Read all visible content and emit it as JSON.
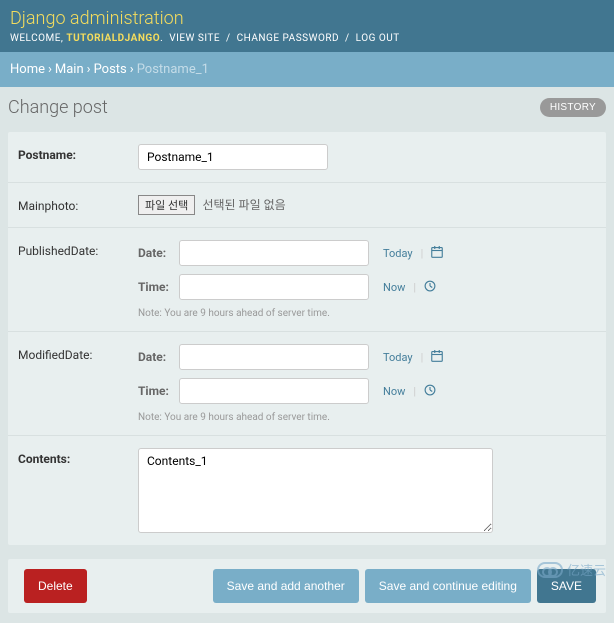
{
  "header": {
    "site_name": "Django administration",
    "welcome": "WELCOME,",
    "username": "TUTORIALDJANGO",
    "view_site": "VIEW SITE",
    "change_password": "CHANGE PASSWORD",
    "logout": "LOG OUT"
  },
  "breadcrumbs": {
    "home": "Home",
    "app": "Main",
    "model": "Posts",
    "current": "Postname_1"
  },
  "page": {
    "title": "Change post",
    "history": "HISTORY"
  },
  "form": {
    "postname": {
      "label": "Postname:",
      "value": "Postname_1"
    },
    "mainphoto": {
      "label": "Mainphoto:",
      "choose": "파일 선택",
      "status": "선택된 파일 없음"
    },
    "published": {
      "label": "PublishedDate:",
      "date_label": "Date:",
      "time_label": "Time:",
      "today": "Today",
      "now": "Now",
      "tz_note": "Note: You are 9 hours ahead of server time."
    },
    "modified": {
      "label": "ModifiedDate:",
      "date_label": "Date:",
      "time_label": "Time:",
      "today": "Today",
      "now": "Now",
      "tz_note": "Note: You are 9 hours ahead of server time."
    },
    "contents": {
      "label": "Contents:",
      "value": "Contents_1"
    }
  },
  "actions": {
    "delete": "Delete",
    "save_add": "Save and add another",
    "save_continue": "Save and continue editing",
    "save": "SAVE"
  },
  "watermark": "亿速云"
}
